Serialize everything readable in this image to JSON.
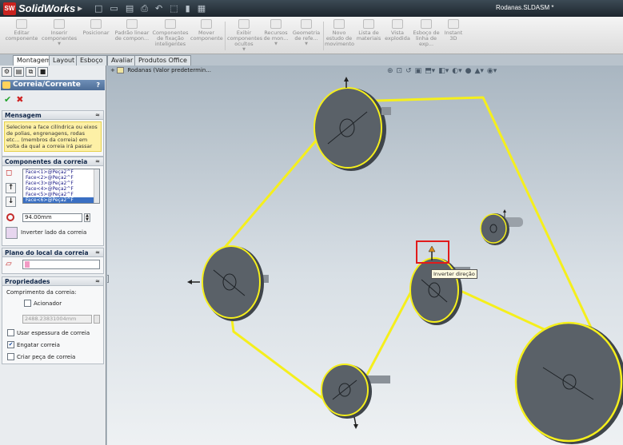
{
  "titlebar": {
    "logo": "SW",
    "app_name": "SolidWorks",
    "document_title": "Rodanas.SLDASM *"
  },
  "commands": [
    {
      "label": "Editar componente"
    },
    {
      "label": "Inserir componentes"
    },
    {
      "label": "Posicionar"
    },
    {
      "label": "Padrão linear de compon..."
    },
    {
      "label": "Componentes de fixação inteligentes"
    },
    {
      "label": "Mover componente"
    },
    {
      "label": "Exibir componentes ocultos"
    },
    {
      "label": "Recursos de mon..."
    },
    {
      "label": "Geometria de refe..."
    },
    {
      "label": "Novo estudo de movimento"
    },
    {
      "label": "Lista de materiais"
    },
    {
      "label": "Vista explodida"
    },
    {
      "label": "Esboço de linha de exp..."
    },
    {
      "label": "Instant 3D"
    }
  ],
  "tabs": [
    {
      "label": "Montagem"
    },
    {
      "label": "Layout"
    },
    {
      "label": "Esboço"
    },
    {
      "label": "Avaliar"
    },
    {
      "label": "Produtos Office"
    }
  ],
  "propertymanager": {
    "title": "Correia/Corrente",
    "help": "?",
    "ok": "✔",
    "cancel": "✖",
    "message": {
      "header": "Mensagem",
      "text": "Selecione a face cilíndrica ou eixos de polias, engrenagens, rodas etc... (membros da correia) em volta da qual a correia irá passar"
    },
    "components": {
      "header": "Componentes da correia",
      "items": [
        "Face<1>@Peça2^F",
        "Face<2>@Peça2^F",
        "Face<3>@Peça2^F",
        "Face<4>@Peça2^F",
        "Face<5>@Peça2^F",
        "Face<6>@Peça2^F"
      ],
      "length_value": "94.00mm",
      "flip_label": "Inverter lado da correia"
    },
    "plane": {
      "header": "Plano do local da correia"
    },
    "properties": {
      "header": "Propriedades",
      "length_label": "Comprimento da correia:",
      "driving_label": "Acionador",
      "length_value": "2488.23831004mm",
      "use_thickness_label": "Usar espessura de correia",
      "engage_label": "Engatar correia",
      "create_part_label": "Criar peça de correia",
      "engage_checked": "✔"
    }
  },
  "viewport": {
    "tree_label": "Rodanas  (Valor predetermin...",
    "tooltip": "Inverter direção",
    "belt_color": "#f5ef1c",
    "pulley_color": "#555b62",
    "highlight_color": "#e11b1b"
  }
}
